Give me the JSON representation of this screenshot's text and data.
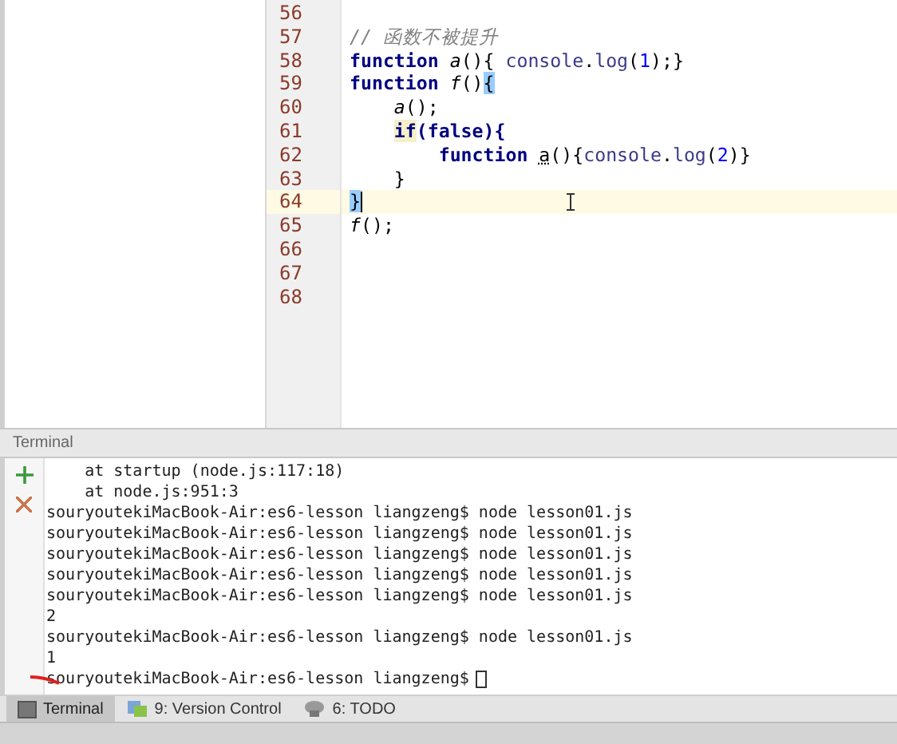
{
  "editor": {
    "lines": [
      {
        "number": "56",
        "current": false
      },
      {
        "number": "57",
        "current": false,
        "tokens": [
          {
            "text": "// 函数不被提升",
            "kind": "comment"
          }
        ]
      },
      {
        "number": "58",
        "current": false,
        "tokens": [
          {
            "text": "function ",
            "kind": "keyword"
          },
          {
            "text": "a",
            "kind": "name"
          },
          {
            "text": "(){ ",
            "kind": "plain"
          },
          {
            "text": "console",
            "kind": "member"
          },
          {
            "text": ".",
            "kind": "plain"
          },
          {
            "text": "log",
            "kind": "member"
          },
          {
            "text": "(",
            "kind": "plain"
          },
          {
            "text": "1",
            "kind": "number"
          },
          {
            "text": ");}",
            "kind": "plain"
          }
        ]
      },
      {
        "number": "59",
        "current": false,
        "tokens": [
          {
            "text": "function ",
            "kind": "keyword"
          },
          {
            "text": "f",
            "kind": "name"
          },
          {
            "text": "()",
            "kind": "plain"
          },
          {
            "text": "{",
            "kind": "brace"
          }
        ]
      },
      {
        "number": "60",
        "current": false,
        "tokens": [
          {
            "text": "    a",
            "kind": "name"
          },
          {
            "text": "();",
            "kind": "plain"
          }
        ]
      },
      {
        "number": "61",
        "current": false,
        "tokens": [
          {
            "text": "    if",
            "kind": "flagged"
          },
          {
            "text": "(false){",
            "kind": "keyword"
          }
        ]
      },
      {
        "number": "62",
        "current": false,
        "tokens": [
          {
            "text": "        function ",
            "kind": "keyword"
          },
          {
            "text": "a",
            "kind": "unused"
          },
          {
            "text": "(){",
            "kind": "plain"
          },
          {
            "text": "console",
            "kind": "member"
          },
          {
            "text": ".",
            "kind": "plain"
          },
          {
            "text": "log",
            "kind": "member"
          },
          {
            "text": "(",
            "kind": "plain"
          },
          {
            "text": "2",
            "kind": "number"
          },
          {
            "text": ")}",
            "kind": "plain"
          }
        ]
      },
      {
        "number": "63",
        "current": false,
        "tokens": [
          {
            "text": "    }",
            "kind": "plain"
          }
        ]
      },
      {
        "number": "64",
        "current": true,
        "tokens": [
          {
            "text": "}",
            "kind": "brace"
          }
        ]
      },
      {
        "number": "65",
        "current": false,
        "tokens": [
          {
            "text": "f",
            "kind": "name"
          },
          {
            "text": "();",
            "kind": "plain"
          }
        ]
      },
      {
        "number": "66",
        "current": false
      },
      {
        "number": "67",
        "current": false
      },
      {
        "number": "68",
        "current": false
      }
    ]
  },
  "terminal": {
    "title": "Terminal",
    "lines": [
      "    at startup (node.js:117:18)",
      "    at node.js:951:3",
      "souryoutekiMacBook-Air:es6-lesson liangzeng$ node lesson01.js",
      "souryoutekiMacBook-Air:es6-lesson liangzeng$ node lesson01.js",
      "souryoutekiMacBook-Air:es6-lesson liangzeng$ node lesson01.js",
      "souryoutekiMacBook-Air:es6-lesson liangzeng$ node lesson01.js",
      "souryoutekiMacBook-Air:es6-lesson liangzeng$ node lesson01.js",
      "2",
      "souryoutekiMacBook-Air:es6-lesson liangzeng$ node lesson01.js",
      "1"
    ],
    "prompt": "souryoutekiMacBook-Air:es6-lesson liangzeng$"
  },
  "tool_tabs": [
    {
      "label": "Terminal",
      "kind": "terminal",
      "selected": true
    },
    {
      "label": "9: Version Control",
      "kind": "vcs",
      "selected": false
    },
    {
      "label": "6: TODO",
      "kind": "todo",
      "selected": false
    }
  ]
}
